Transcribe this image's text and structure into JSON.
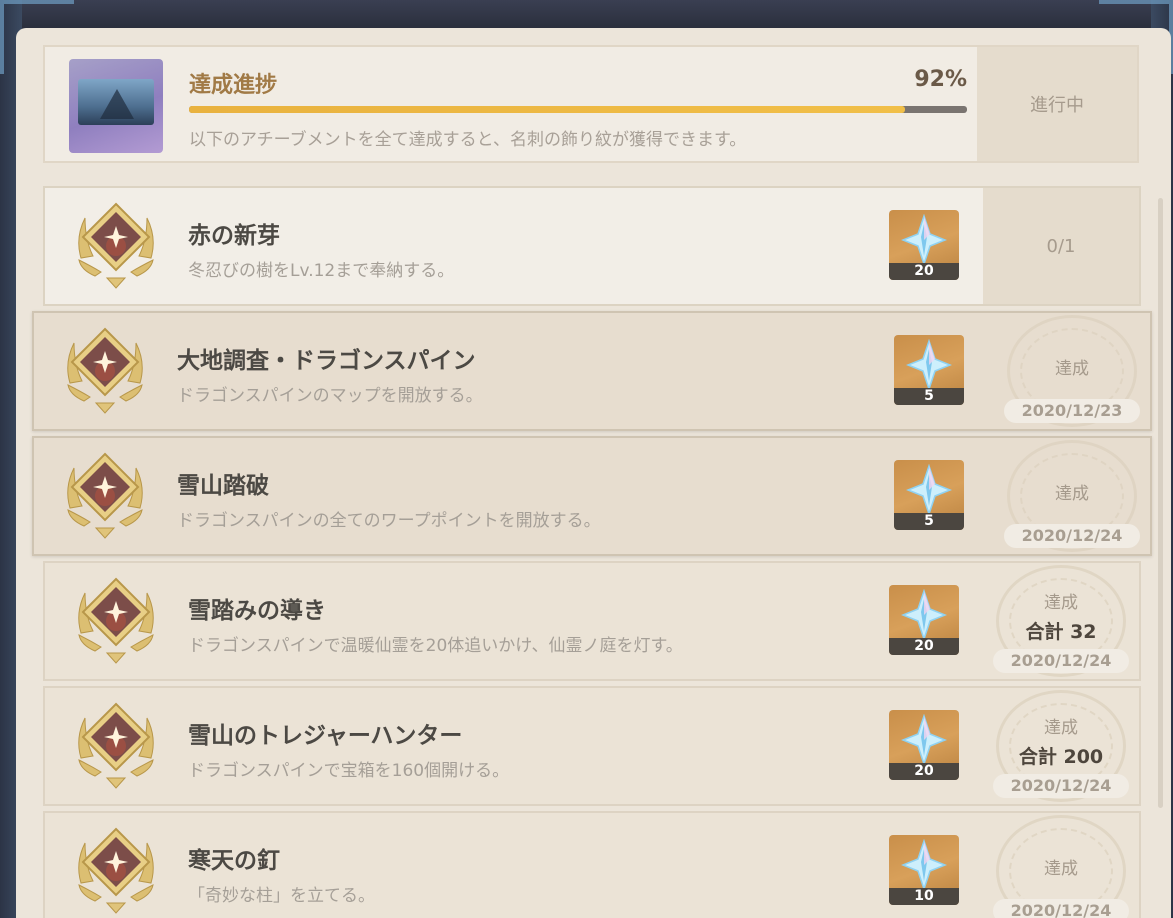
{
  "progress": {
    "title": "達成進捗",
    "percent_text": "92%",
    "percent": 0.92,
    "description": "以下のアチーブメントを全て達成すると、名刺の飾り紋が獲得できます。",
    "status": "進行中"
  },
  "achievements": [
    {
      "title": "赤の新芽",
      "description": "冬忍びの樹をLv.12まで奉納する。",
      "reward": "20",
      "status": "0/1",
      "completed": false
    },
    {
      "title": "大地調査・ドラゴンスパイン",
      "description": "ドラゴンスパインのマップを開放する。",
      "reward": "5",
      "status": "達成",
      "date": "2020/12/23",
      "completed": true
    },
    {
      "title": "雪山踏破",
      "description": "ドラゴンスパインの全てのワープポイントを開放する。",
      "reward": "5",
      "status": "達成",
      "date": "2020/12/24",
      "completed": true
    },
    {
      "title": "雪踏みの導き",
      "description": "ドラゴンスパインで温暖仙霊を20体追いかけ、仙霊ノ庭を灯す。",
      "reward": "20",
      "status": "達成",
      "total": "合計 32",
      "date": "2020/12/24",
      "completed": true
    },
    {
      "title": "雪山のトレジャーハンター",
      "description": "ドラゴンスパインで宝箱を160個開ける。",
      "reward": "20",
      "status": "達成",
      "total": "合計 200",
      "date": "2020/12/24",
      "completed": true
    },
    {
      "title": "寒天の釘",
      "description": "「奇妙な柱」を立てる。",
      "reward": "10",
      "status": "達成",
      "date": "2020/12/24",
      "completed": true
    }
  ],
  "colors": {
    "panel_bg": "#ece5da",
    "progress_fill": "#f1bf48",
    "title_gold": "#a17a46"
  }
}
